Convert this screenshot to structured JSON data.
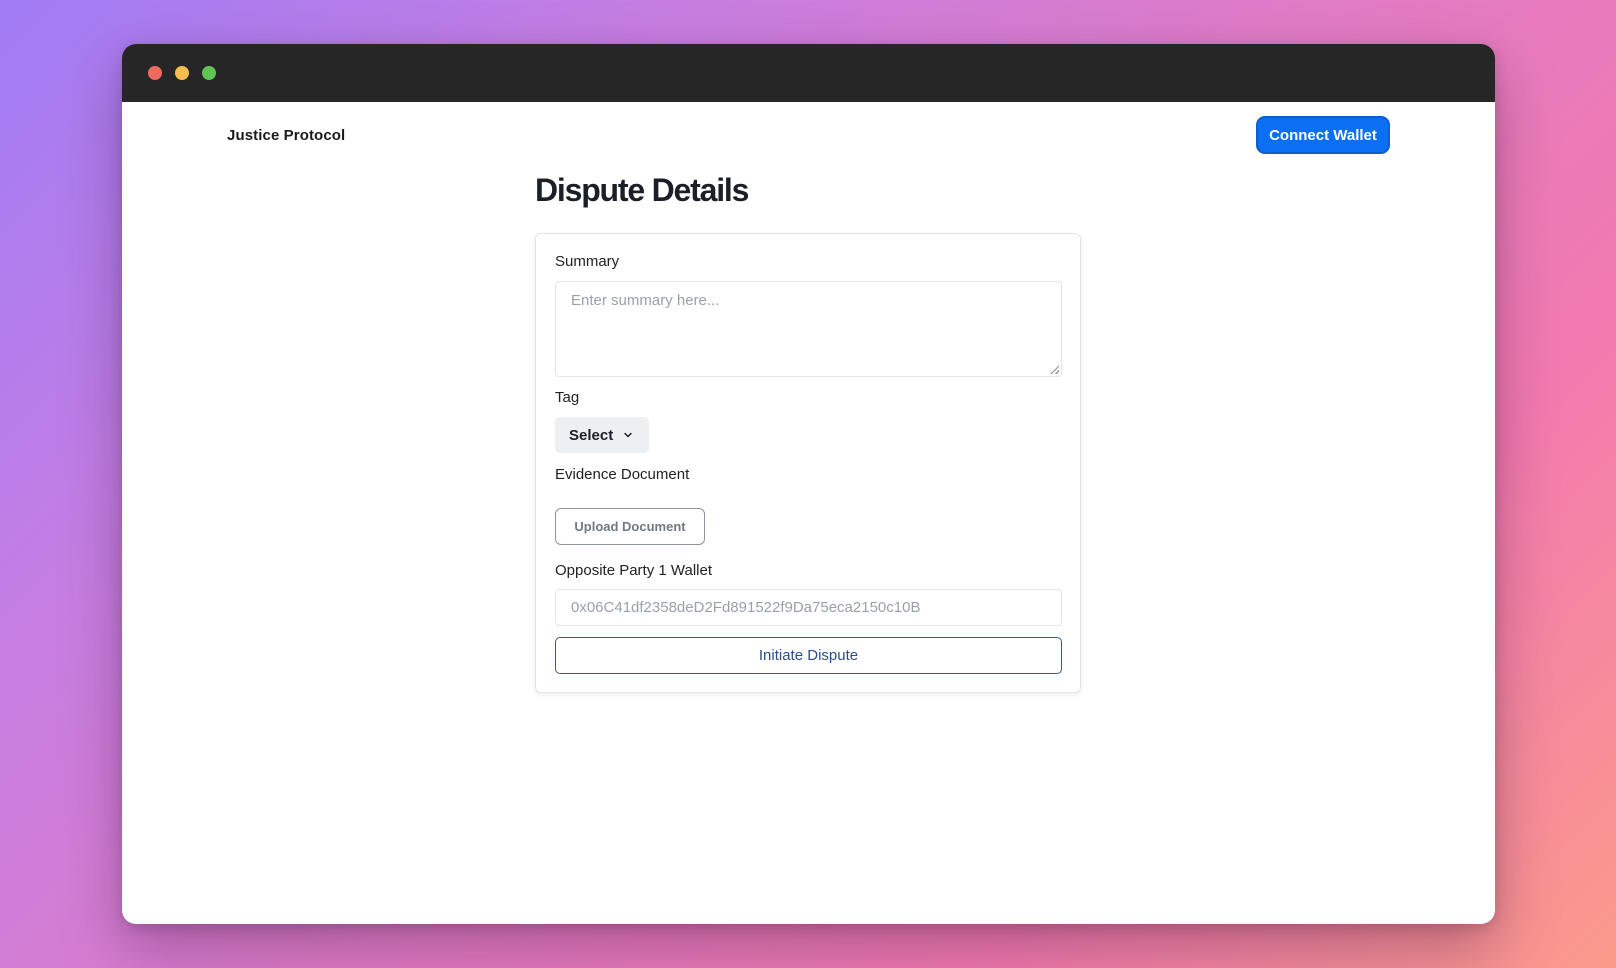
{
  "app": {
    "brand": "Justice Protocol",
    "connect_wallet_label": "Connect Wallet"
  },
  "page": {
    "title": "Dispute Details"
  },
  "form": {
    "summary_label": "Summary",
    "summary_placeholder": "Enter summary here...",
    "tag_label": "Tag",
    "tag_selected": "Select",
    "evidence_label": "Evidence Document",
    "upload_label": "Upload Document",
    "wallet_label": "Opposite Party 1 Wallet",
    "wallet_placeholder": "0x06C41df2358deD2Fd891522f9Da75eca2150c10B",
    "submit_label": "Initiate Dispute"
  },
  "colors": {
    "accent": "#0a6ff2",
    "submit_text": "#2b4f8a",
    "titlebar": "#262626"
  },
  "icons": {
    "window_controls": [
      "close-dot",
      "minimize-dot",
      "maximize-dot"
    ],
    "select_chevron": "chevron-down-icon"
  }
}
